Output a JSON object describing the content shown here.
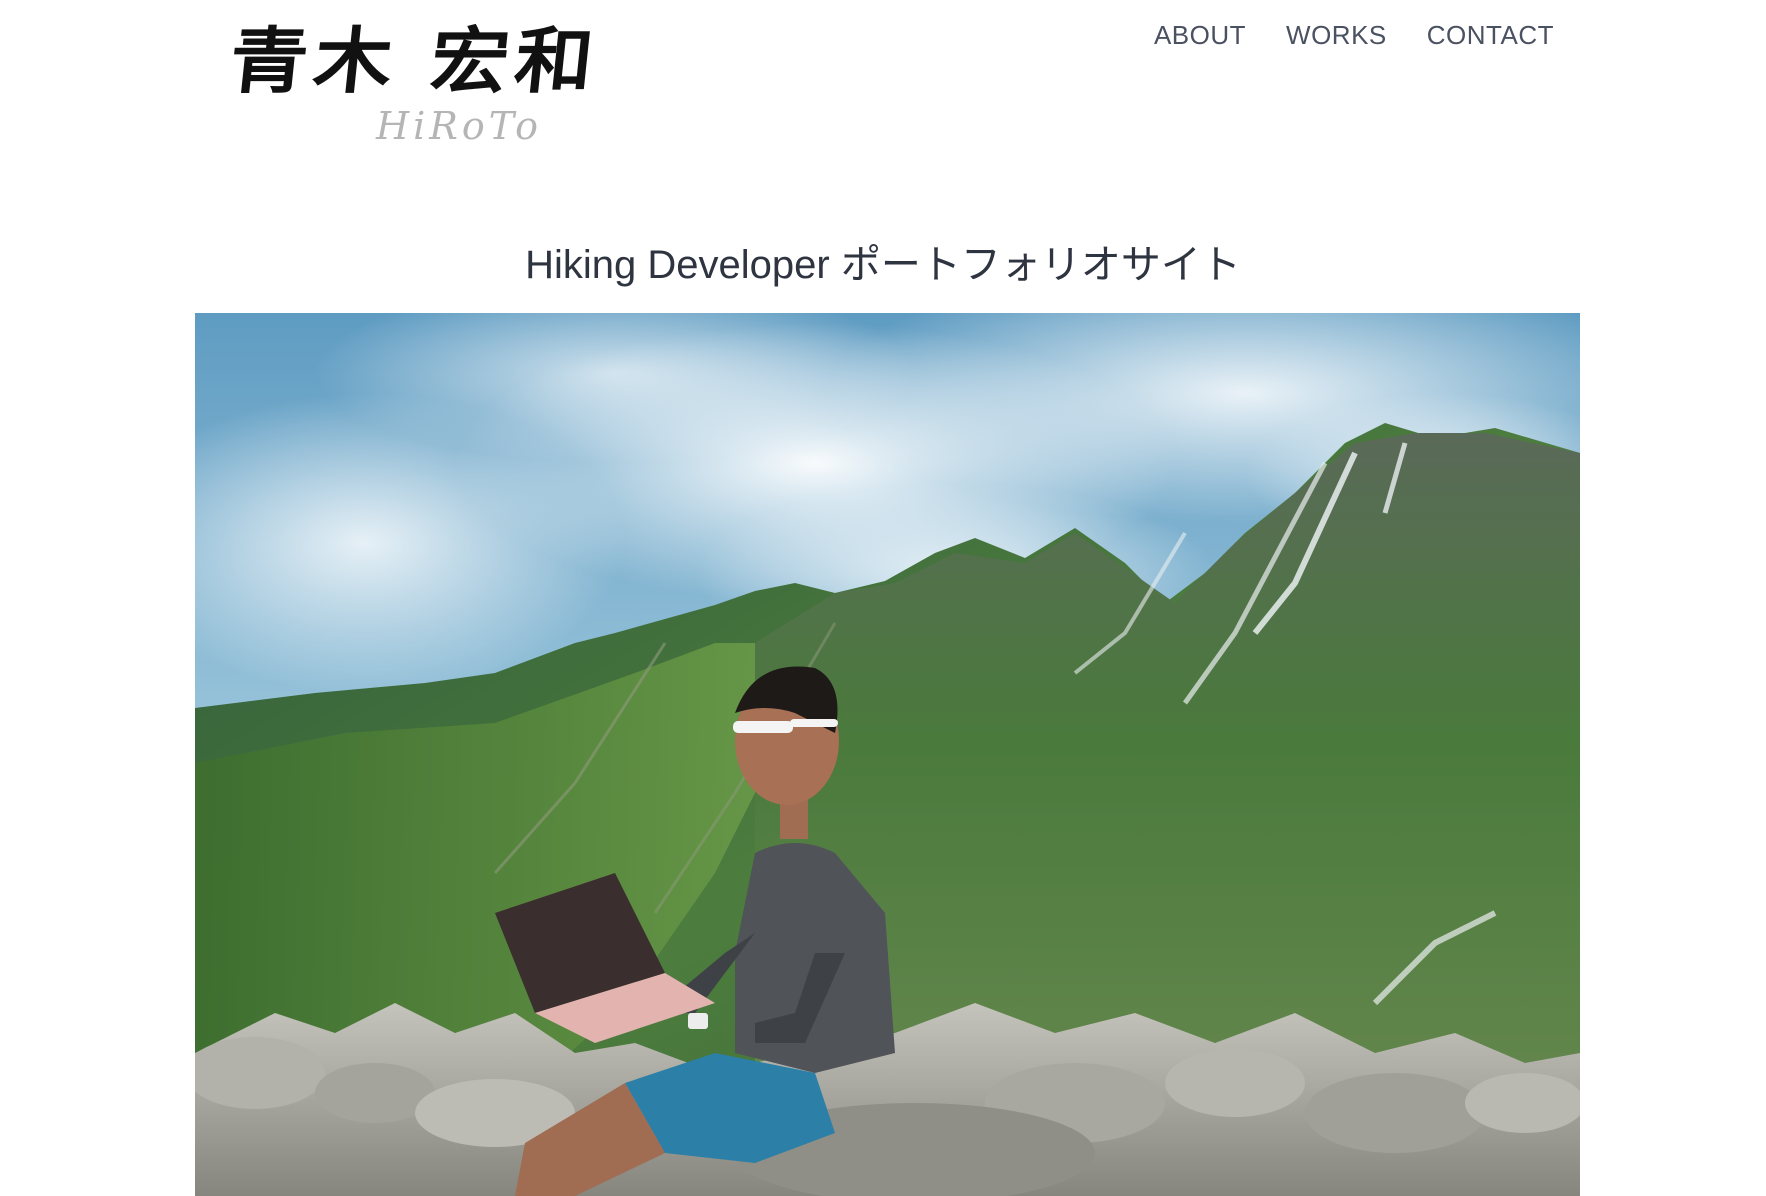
{
  "header": {
    "logo_kanji": "青木 宏和",
    "logo_sub": "HiRoTo",
    "nav": [
      "ABOUT",
      "WORKS",
      "CONTACT"
    ]
  },
  "main": {
    "tagline": "Hiking Developer ポートフォリオサイト"
  },
  "hero": {
    "subject": "hiker-with-laptop-on-mountain-ridge"
  },
  "colors": {
    "nav_text": "#4a5160",
    "title_text": "#2f3441",
    "sky": "#7fb0cc",
    "mountain_green": "#3f6e3a",
    "rock_gray": "#9c9c94"
  }
}
